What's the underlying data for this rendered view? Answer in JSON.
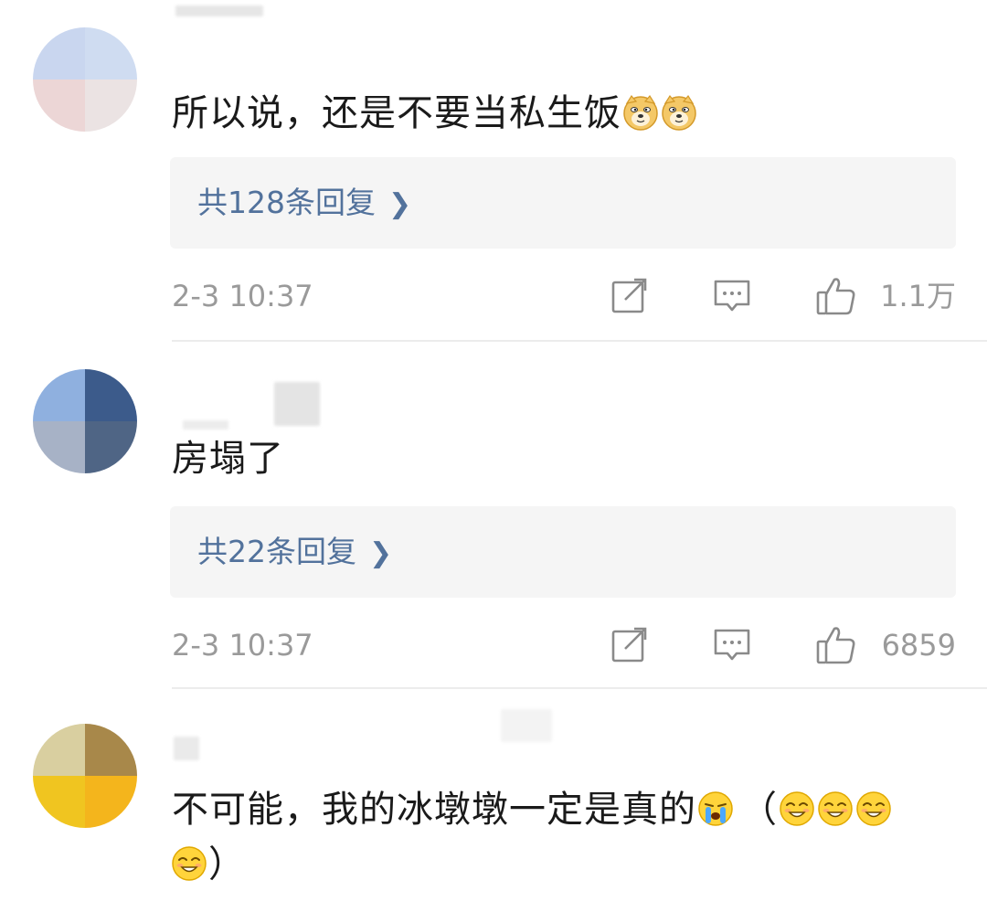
{
  "comments": [
    {
      "text": "所以说，还是不要当私生饭",
      "trailing_emojis": [
        "doge-emoji",
        "doge-emoji"
      ],
      "replies_label": "共128条回复",
      "time": "2-3 10:37",
      "likes": "1.1万"
    },
    {
      "text": "房塌了",
      "replies_label": "共22条回复",
      "time": "2-3 10:37",
      "likes": "6859"
    },
    {
      "text_part1": "不可能，我的冰墩墩一定是真的",
      "text_part2": "（",
      "text_part3": "）",
      "emojis": [
        "crying-emoji",
        "grin-emoji",
        "grin-emoji",
        "grin-emoji",
        "grin-emoji"
      ]
    }
  ],
  "icons": {
    "share": "share-icon",
    "comment": "comment-icon",
    "like": "thumbs-up-icon",
    "chevron": "chevron-right-icon"
  },
  "colors": {
    "link": "#52729c",
    "meta": "#9a9a9a",
    "reply_bg": "#f5f5f5",
    "divider": "#ececec"
  }
}
